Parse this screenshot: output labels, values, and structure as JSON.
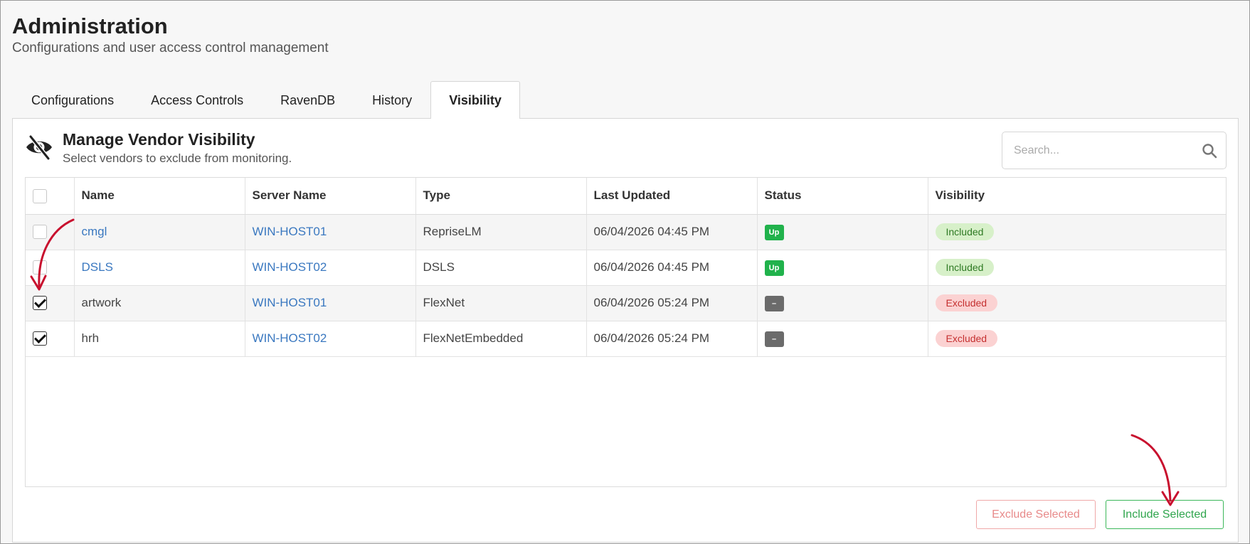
{
  "page": {
    "title": "Administration",
    "subtitle": "Configurations and user access control management"
  },
  "tabs": [
    {
      "label": "Configurations",
      "active": false
    },
    {
      "label": "Access Controls",
      "active": false
    },
    {
      "label": "RavenDB",
      "active": false
    },
    {
      "label": "History",
      "active": false
    },
    {
      "label": "Visibility",
      "active": true
    }
  ],
  "panel": {
    "icon": "eye-slash-icon",
    "title": "Manage Vendor Visibility",
    "subtitle": "Select vendors to exclude from monitoring.",
    "search_placeholder": "Search..."
  },
  "table": {
    "columns": [
      "Name",
      "Server Name",
      "Type",
      "Last Updated",
      "Status",
      "Visibility"
    ],
    "rows": [
      {
        "checked": false,
        "name": "cmgl",
        "name_link": true,
        "server": "WIN-HOST01",
        "type": "RepriseLM",
        "updated": "06/04/2026 04:45 PM",
        "status": "Up",
        "visibility": "Included"
      },
      {
        "checked": false,
        "name": "DSLS",
        "name_link": true,
        "server": "WIN-HOST02",
        "type": "DSLS",
        "updated": "06/04/2026 04:45 PM",
        "status": "Up",
        "visibility": "Included"
      },
      {
        "checked": true,
        "name": "artwork",
        "name_link": false,
        "server": "WIN-HOST01",
        "type": "FlexNet",
        "updated": "06/04/2026 05:24 PM",
        "status": "–",
        "visibility": "Excluded"
      },
      {
        "checked": true,
        "name": "hrh",
        "name_link": false,
        "server": "WIN-HOST02",
        "type": "FlexNetEmbedded",
        "updated": "06/04/2026 05:24 PM",
        "status": "–",
        "visibility": "Excluded"
      }
    ]
  },
  "buttons": {
    "exclude": "Exclude Selected",
    "include": "Include Selected"
  },
  "colors": {
    "link": "#3a78c0",
    "status_up": "#21b24c",
    "status_unknown": "#6b6b6b",
    "included_bg": "#d7f0c9",
    "excluded_bg": "#fbd2d2",
    "annotation_arrow": "#c8102e"
  }
}
